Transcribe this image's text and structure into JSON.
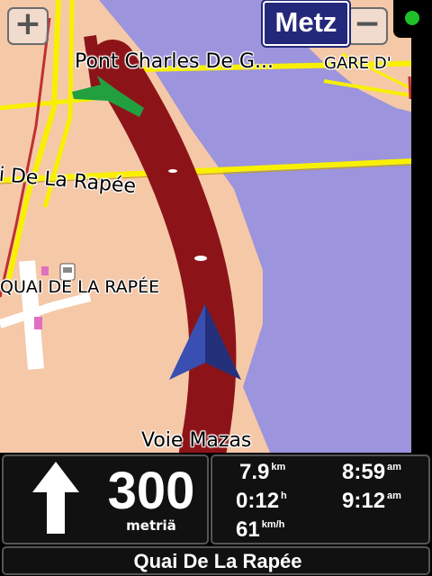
{
  "map": {
    "city": "Metz",
    "zoom_in": "+",
    "zoom_out": "−",
    "labels": {
      "bridge": "Pont Charles De G...",
      "station": "GARE D'",
      "quai_road": "i De La Rapée",
      "poi": "QUAI DE LA RAPÉE",
      "voie": "Voie Mazas"
    }
  },
  "colors": {
    "water": "#9c94dc",
    "land": "#f5c8a8",
    "route": "#8c1418",
    "road": "#f8f000",
    "arrow": "#3a4fb2",
    "gps": "#1fc12a",
    "city_bg": "#24287a"
  },
  "instruction": {
    "icon": "arrow-straight-icon",
    "distance": "300",
    "unit": "metriä"
  },
  "trip": {
    "remaining_distance": "7.9",
    "remaining_distance_unit": "km",
    "remaining_time": "0:12",
    "remaining_time_unit": "h",
    "speed": "61",
    "speed_unit": "km/h",
    "current_time": "8:59",
    "current_time_unit": "am",
    "arrival_time": "9:12",
    "arrival_time_unit": "am"
  },
  "street": "Quai De La Rapée"
}
